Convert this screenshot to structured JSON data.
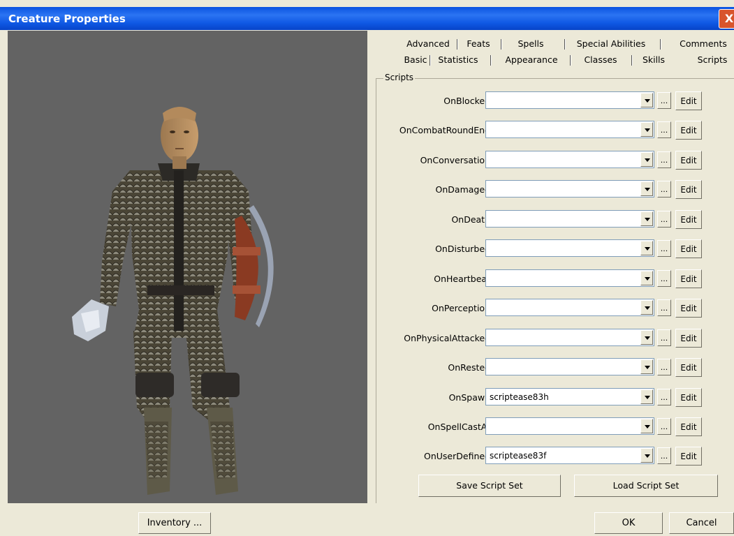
{
  "window": {
    "title": "Creature Properties",
    "close_glyph": "X"
  },
  "tabs": {
    "row1": [
      "Advanced",
      "Feats",
      "Spells",
      "Special Abilities",
      "Comments"
    ],
    "row2": [
      "Basic",
      "Statistics",
      "Appearance",
      "Classes",
      "Skills",
      "Scripts"
    ],
    "active": "Scripts"
  },
  "scripts_group": {
    "label": "Scripts",
    "rows": [
      {
        "event": "OnBlocked",
        "value": "",
        "browse_label": "...",
        "edit_label": "Edit"
      },
      {
        "event": "OnCombatRoundEnd",
        "value": "",
        "browse_label": "...",
        "edit_label": "Edit"
      },
      {
        "event": "OnConversation",
        "value": "",
        "browse_label": "...",
        "edit_label": "Edit"
      },
      {
        "event": "OnDamaged",
        "value": "",
        "browse_label": "...",
        "edit_label": "Edit"
      },
      {
        "event": "OnDeath",
        "value": "",
        "browse_label": "...",
        "edit_label": "Edit"
      },
      {
        "event": "OnDisturbed",
        "value": "",
        "browse_label": "...",
        "edit_label": "Edit"
      },
      {
        "event": "OnHeartbeat",
        "value": "",
        "browse_label": "...",
        "edit_label": "Edit"
      },
      {
        "event": "OnPerception",
        "value": "",
        "browse_label": "...",
        "edit_label": "Edit"
      },
      {
        "event": "OnPhysicalAttacked",
        "value": "",
        "browse_label": "...",
        "edit_label": "Edit"
      },
      {
        "event": "OnRested",
        "value": "",
        "browse_label": "...",
        "edit_label": "Edit"
      },
      {
        "event": "OnSpawn",
        "value": "scriptease83h",
        "browse_label": "...",
        "edit_label": "Edit"
      },
      {
        "event": "OnSpellCastAt",
        "value": "",
        "browse_label": "...",
        "edit_label": "Edit"
      },
      {
        "event": "OnUserDefined",
        "value": "scriptease83f",
        "browse_label": "...",
        "edit_label": "Edit"
      }
    ],
    "save_label": "Save Script Set",
    "load_label": "Load Script Set"
  },
  "footer": {
    "inventory_label": "Inventory ...",
    "ok_label": "OK",
    "cancel_label": "Cancel"
  },
  "colors": {
    "titlebar": "#0a53e0",
    "dialog_bg": "#ece9d8",
    "viewport_bg": "#636363",
    "close": "#d8542c"
  }
}
